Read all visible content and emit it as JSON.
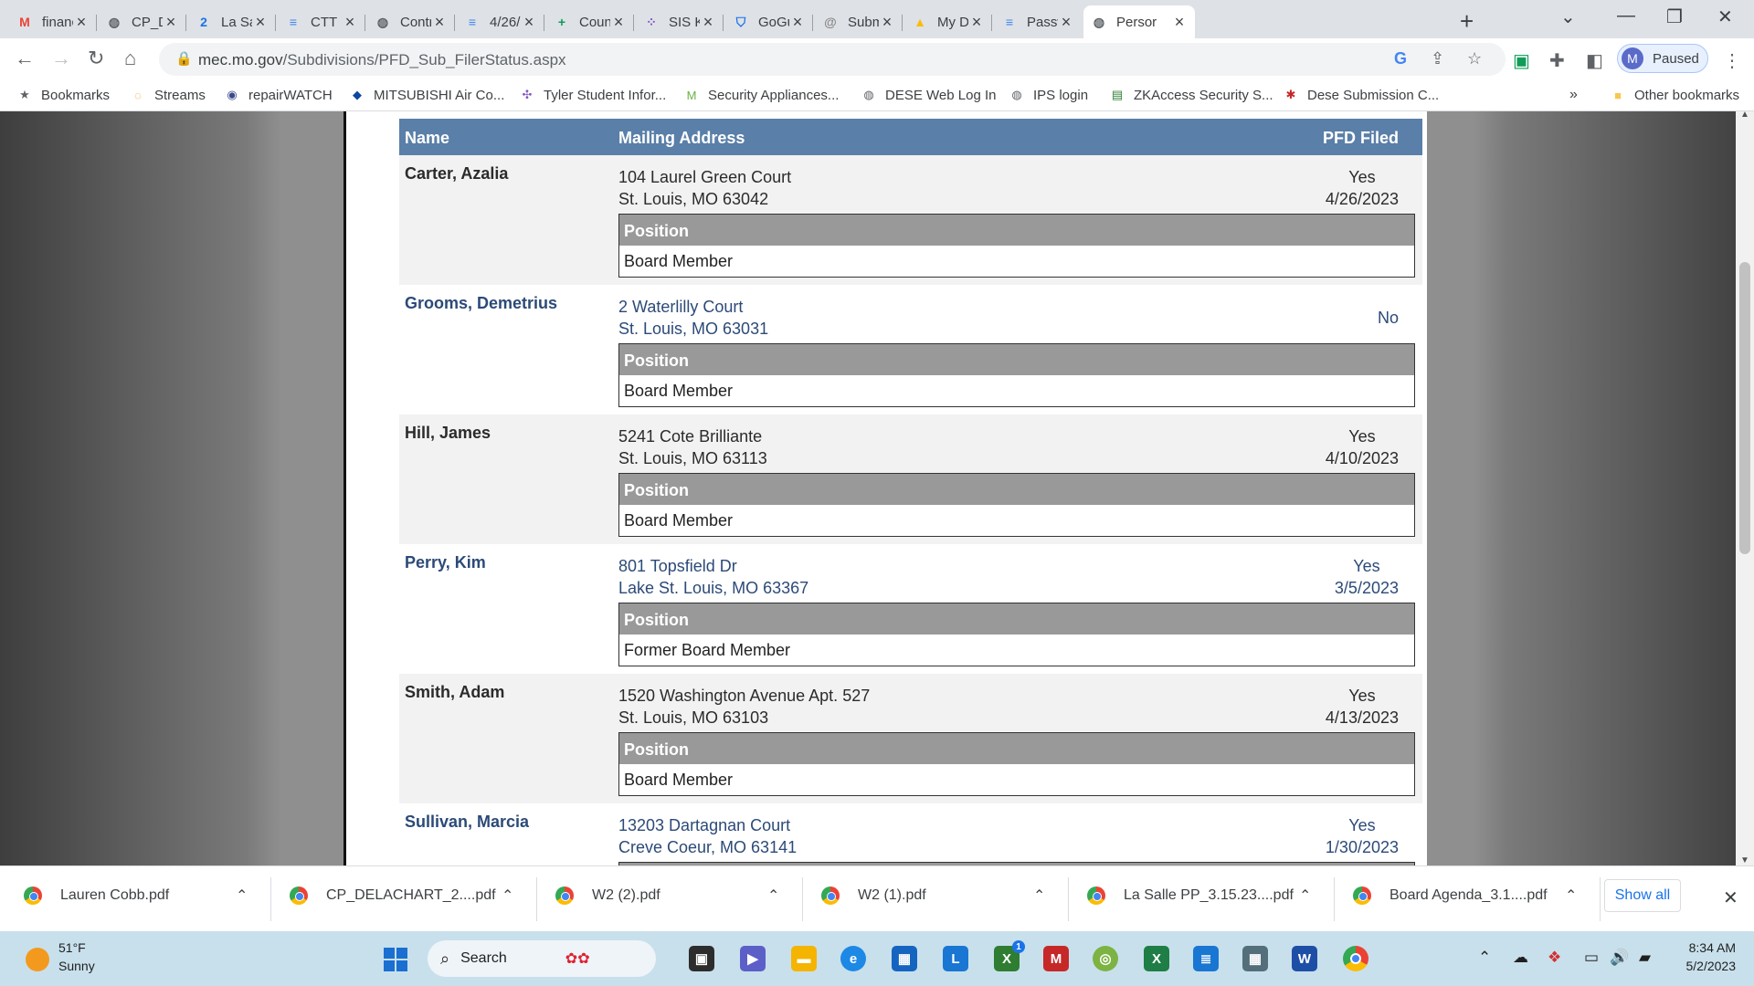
{
  "browser": {
    "tabs": [
      {
        "title": "financ",
        "icon": "gmail-icon",
        "color": "#ea4335",
        "glyph": "M"
      },
      {
        "title": "CP_DE",
        "icon": "globe-icon",
        "color": "#5f6368",
        "glyph": "◍"
      },
      {
        "title": "La Sall",
        "icon": "calendar-icon",
        "color": "#1a73e8",
        "glyph": "2"
      },
      {
        "title": "CTT M",
        "icon": "docs-icon",
        "color": "#4285f4",
        "glyph": "≡"
      },
      {
        "title": "Contra",
        "icon": "globe-icon",
        "color": "#5f6368",
        "glyph": "◍"
      },
      {
        "title": "4/26/2",
        "icon": "docs-icon",
        "color": "#4285f4",
        "glyph": "≡"
      },
      {
        "title": "Couns",
        "icon": "sheets-plus-icon",
        "color": "#0f9d58",
        "glyph": "+"
      },
      {
        "title": "SIS K-",
        "icon": "sis-icon",
        "color": "#7e57c2",
        "glyph": "⁘"
      },
      {
        "title": "GoGu",
        "icon": "shield-icon",
        "color": "#1a73e8",
        "glyph": "⛉"
      },
      {
        "title": "Submi",
        "icon": "swirl-icon",
        "color": "#8a8a8a",
        "glyph": "@"
      },
      {
        "title": "My Dr",
        "icon": "drive-icon",
        "color": "#fbbc05",
        "glyph": "▲"
      },
      {
        "title": "Passw",
        "icon": "docs-icon",
        "color": "#4285f4",
        "glyph": "≡"
      },
      {
        "title": "Persor",
        "icon": "globe-icon",
        "color": "#5f6368",
        "glyph": "◍"
      }
    ],
    "url_host": "mec.mo.gov",
    "url_path": "/Subdivisions/PFD_Sub_FilerStatus.aspx",
    "profile_initial": "M",
    "profile_status": "Paused",
    "bookmarks": [
      {
        "label": "Bookmarks",
        "icon": "star-icon",
        "glyph": "★",
        "color": "#5f6368"
      },
      {
        "label": "Streams",
        "icon": "streams-icon",
        "glyph": "◌",
        "color": "#e8a000"
      },
      {
        "label": "repairWATCH",
        "icon": "eye-icon",
        "glyph": "◉",
        "color": "#3c4a8c"
      },
      {
        "label": "MITSUBISHI Air Co...",
        "icon": "mitsubishi-icon",
        "glyph": "◆",
        "color": "#0d47a1"
      },
      {
        "label": "Tyler Student Infor...",
        "icon": "tyler-icon",
        "glyph": "✣",
        "color": "#7e57c2"
      },
      {
        "label": "Security Appliances...",
        "icon": "meraki-icon",
        "glyph": "M",
        "color": "#67b346"
      },
      {
        "label": "DESE Web Log In",
        "icon": "globe-icon",
        "glyph": "◍",
        "color": "#5f6368"
      },
      {
        "label": "IPS login",
        "icon": "globe-icon",
        "glyph": "◍",
        "color": "#5f6368"
      },
      {
        "label": "ZKAccess Security S...",
        "icon": "zkaccess-icon",
        "glyph": "▤",
        "color": "#2e7d32"
      },
      {
        "label": "Dese Submission C...",
        "icon": "dese-icon",
        "glyph": "✱",
        "color": "#c62828"
      }
    ],
    "overflow": "»",
    "other_bookmarks": "Other bookmarks"
  },
  "table": {
    "headers": {
      "name": "Name",
      "address": "Mailing Address",
      "filed": "PFD Filed"
    },
    "position_header": "Position",
    "rows": [
      {
        "name": "Carter, Azalia",
        "addr1": "104 Laurel Green Court",
        "addr2": "St. Louis, MO 63042",
        "filed": "Yes",
        "date": "4/26/2023",
        "position": "Board Member"
      },
      {
        "name": "Grooms, Demetrius",
        "addr1": "2 Waterlilly Court",
        "addr2": "St. Louis, MO 63031",
        "filed": "No",
        "date": "",
        "position": "Board Member"
      },
      {
        "name": "Hill, James",
        "addr1": "5241 Cote Brilliante",
        "addr2": "St. Louis, MO 63113",
        "filed": "Yes",
        "date": "4/10/2023",
        "position": "Board Member"
      },
      {
        "name": "Perry, Kim",
        "addr1": "801 Topsfield Dr",
        "addr2": "Lake St. Louis, MO 63367",
        "filed": "Yes",
        "date": "3/5/2023",
        "position": "Former Board Member"
      },
      {
        "name": "Smith, Adam",
        "addr1": "1520 Washington Avenue Apt. 527",
        "addr2": "St. Louis, MO 63103",
        "filed": "Yes",
        "date": "4/13/2023",
        "position": "Board Member"
      },
      {
        "name": "Sullivan, Marcia",
        "addr1": "13203 Dartagnan Court",
        "addr2": "Creve Coeur, MO 63141",
        "filed": "Yes",
        "date": "1/30/2023",
        "position": ""
      }
    ]
  },
  "downloads": {
    "files": [
      "Lauren Cobb.pdf",
      "CP_DELACHART_2....pdf",
      "W2 (2).pdf",
      "W2 (1).pdf",
      "La Salle PP_3.15.23....pdf",
      "Board Agenda_3.1....pdf"
    ],
    "show_all": "Show all"
  },
  "taskbar": {
    "temperature": "51°F",
    "condition": "Sunny",
    "search_label": "Search",
    "time": "8:34 AM",
    "date": "5/2/2023",
    "badge_count": "1"
  },
  "colors": {
    "header_bg": "#5a7fa8",
    "link_blue": "#2c4a78",
    "position_header_bg": "#999999"
  }
}
